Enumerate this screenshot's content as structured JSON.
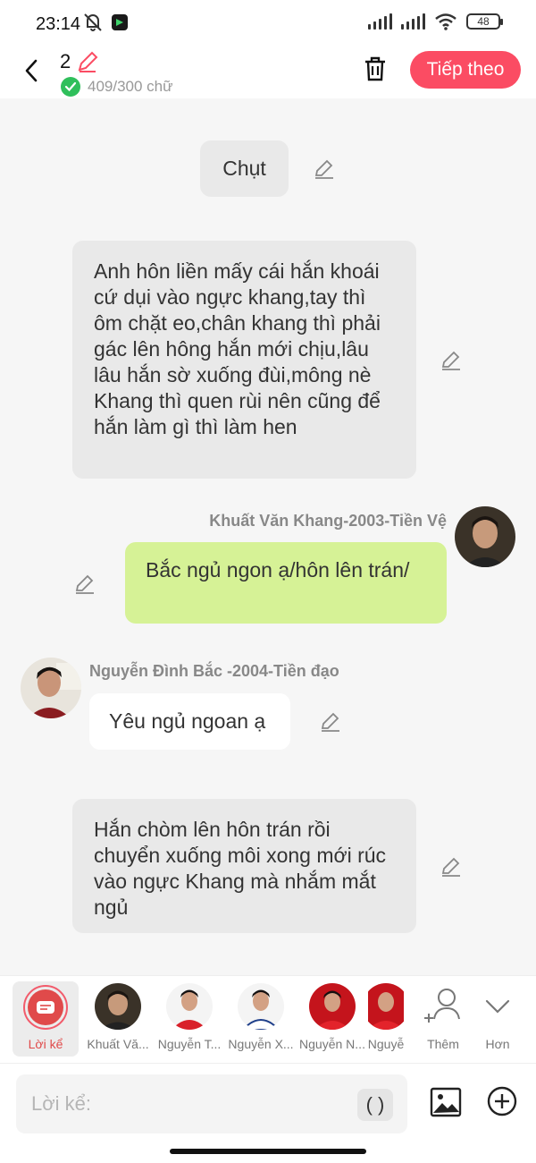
{
  "status_bar": {
    "time": "23:14",
    "battery": "48"
  },
  "header": {
    "count": "2",
    "word_count": "409/300 chữ",
    "next_label": "Tiếp theo"
  },
  "messages": {
    "m1": "Chụt",
    "m2": "Anh hôn liền mấy cái hắn khoái cứ dụi vào ngực khang,tay thì ôm chặt eo,chân khang thì phải gác lên hông hắn mới chịu,lâu lâu hắn sờ xuống đùi,mông nè Khang thì quen rùi nên cũng để hắn làm gì thì làm hen",
    "m3_name": "Khuất Văn Khang-2003-Tiền Vệ",
    "m3": "Bắc ngủ ngon ạ/hôn lên trán/",
    "m4_name": "Nguyễn Đình Bắc -2004-Tiền đạo",
    "m4": "Yêu ngủ ngoan ạ",
    "m5": "Hắn chòm lên hôn trán rồi chuyển xuống môi xong mới rúc vào ngực Khang mà nhắm mắt ngủ"
  },
  "characters": {
    "narrator": "Lời kể",
    "c1": "Khuất Vă...",
    "c2": "Nguyễn T...",
    "c3": "Nguyễn X...",
    "c4": "Nguyễn N...",
    "c5": "Nguyễ",
    "more": "Thêm",
    "collapse": "Hơn"
  },
  "input": {
    "placeholder": "Lời kể:",
    "paren_label": "( )"
  },
  "colors": {
    "accent": "#fb4c63",
    "green_bubble": "#d6f296",
    "narration_bg": "#e9e9e9"
  }
}
